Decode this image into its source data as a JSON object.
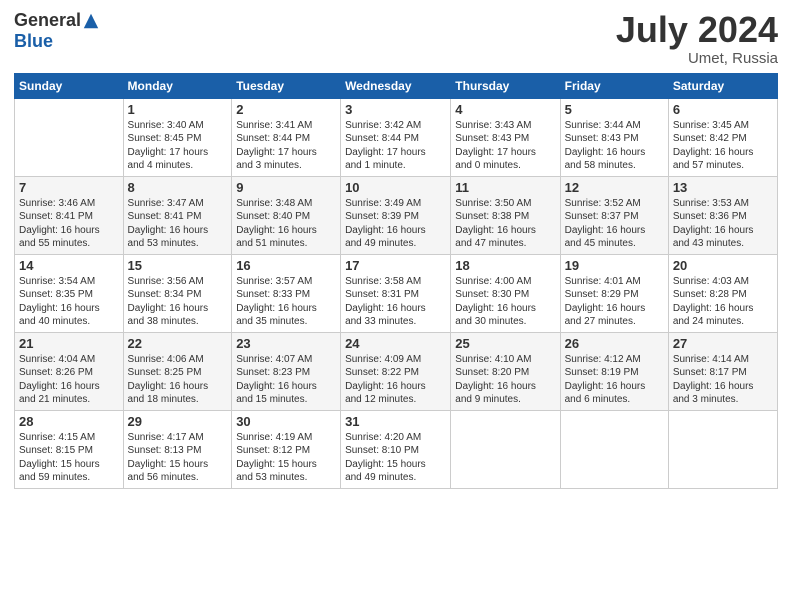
{
  "header": {
    "logo_general": "General",
    "logo_blue": "Blue",
    "main_title": "July 2024",
    "subtitle": "Umet, Russia"
  },
  "calendar": {
    "days_of_week": [
      "Sunday",
      "Monday",
      "Tuesday",
      "Wednesday",
      "Thursday",
      "Friday",
      "Saturday"
    ],
    "weeks": [
      [
        {
          "day": "",
          "info": ""
        },
        {
          "day": "1",
          "info": "Sunrise: 3:40 AM\nSunset: 8:45 PM\nDaylight: 17 hours\nand 4 minutes."
        },
        {
          "day": "2",
          "info": "Sunrise: 3:41 AM\nSunset: 8:44 PM\nDaylight: 17 hours\nand 3 minutes."
        },
        {
          "day": "3",
          "info": "Sunrise: 3:42 AM\nSunset: 8:44 PM\nDaylight: 17 hours\nand 1 minute."
        },
        {
          "day": "4",
          "info": "Sunrise: 3:43 AM\nSunset: 8:43 PM\nDaylight: 17 hours\nand 0 minutes."
        },
        {
          "day": "5",
          "info": "Sunrise: 3:44 AM\nSunset: 8:43 PM\nDaylight: 16 hours\nand 58 minutes."
        },
        {
          "day": "6",
          "info": "Sunrise: 3:45 AM\nSunset: 8:42 PM\nDaylight: 16 hours\nand 57 minutes."
        }
      ],
      [
        {
          "day": "7",
          "info": "Sunrise: 3:46 AM\nSunset: 8:41 PM\nDaylight: 16 hours\nand 55 minutes."
        },
        {
          "day": "8",
          "info": "Sunrise: 3:47 AM\nSunset: 8:41 PM\nDaylight: 16 hours\nand 53 minutes."
        },
        {
          "day": "9",
          "info": "Sunrise: 3:48 AM\nSunset: 8:40 PM\nDaylight: 16 hours\nand 51 minutes."
        },
        {
          "day": "10",
          "info": "Sunrise: 3:49 AM\nSunset: 8:39 PM\nDaylight: 16 hours\nand 49 minutes."
        },
        {
          "day": "11",
          "info": "Sunrise: 3:50 AM\nSunset: 8:38 PM\nDaylight: 16 hours\nand 47 minutes."
        },
        {
          "day": "12",
          "info": "Sunrise: 3:52 AM\nSunset: 8:37 PM\nDaylight: 16 hours\nand 45 minutes."
        },
        {
          "day": "13",
          "info": "Sunrise: 3:53 AM\nSunset: 8:36 PM\nDaylight: 16 hours\nand 43 minutes."
        }
      ],
      [
        {
          "day": "14",
          "info": "Sunrise: 3:54 AM\nSunset: 8:35 PM\nDaylight: 16 hours\nand 40 minutes."
        },
        {
          "day": "15",
          "info": "Sunrise: 3:56 AM\nSunset: 8:34 PM\nDaylight: 16 hours\nand 38 minutes."
        },
        {
          "day": "16",
          "info": "Sunrise: 3:57 AM\nSunset: 8:33 PM\nDaylight: 16 hours\nand 35 minutes."
        },
        {
          "day": "17",
          "info": "Sunrise: 3:58 AM\nSunset: 8:31 PM\nDaylight: 16 hours\nand 33 minutes."
        },
        {
          "day": "18",
          "info": "Sunrise: 4:00 AM\nSunset: 8:30 PM\nDaylight: 16 hours\nand 30 minutes."
        },
        {
          "day": "19",
          "info": "Sunrise: 4:01 AM\nSunset: 8:29 PM\nDaylight: 16 hours\nand 27 minutes."
        },
        {
          "day": "20",
          "info": "Sunrise: 4:03 AM\nSunset: 8:28 PM\nDaylight: 16 hours\nand 24 minutes."
        }
      ],
      [
        {
          "day": "21",
          "info": "Sunrise: 4:04 AM\nSunset: 8:26 PM\nDaylight: 16 hours\nand 21 minutes."
        },
        {
          "day": "22",
          "info": "Sunrise: 4:06 AM\nSunset: 8:25 PM\nDaylight: 16 hours\nand 18 minutes."
        },
        {
          "day": "23",
          "info": "Sunrise: 4:07 AM\nSunset: 8:23 PM\nDaylight: 16 hours\nand 15 minutes."
        },
        {
          "day": "24",
          "info": "Sunrise: 4:09 AM\nSunset: 8:22 PM\nDaylight: 16 hours\nand 12 minutes."
        },
        {
          "day": "25",
          "info": "Sunrise: 4:10 AM\nSunset: 8:20 PM\nDaylight: 16 hours\nand 9 minutes."
        },
        {
          "day": "26",
          "info": "Sunrise: 4:12 AM\nSunset: 8:19 PM\nDaylight: 16 hours\nand 6 minutes."
        },
        {
          "day": "27",
          "info": "Sunrise: 4:14 AM\nSunset: 8:17 PM\nDaylight: 16 hours\nand 3 minutes."
        }
      ],
      [
        {
          "day": "28",
          "info": "Sunrise: 4:15 AM\nSunset: 8:15 PM\nDaylight: 15 hours\nand 59 minutes."
        },
        {
          "day": "29",
          "info": "Sunrise: 4:17 AM\nSunset: 8:13 PM\nDaylight: 15 hours\nand 56 minutes."
        },
        {
          "day": "30",
          "info": "Sunrise: 4:19 AM\nSunset: 8:12 PM\nDaylight: 15 hours\nand 53 minutes."
        },
        {
          "day": "31",
          "info": "Sunrise: 4:20 AM\nSunset: 8:10 PM\nDaylight: 15 hours\nand 49 minutes."
        },
        {
          "day": "",
          "info": ""
        },
        {
          "day": "",
          "info": ""
        },
        {
          "day": "",
          "info": ""
        }
      ]
    ]
  }
}
